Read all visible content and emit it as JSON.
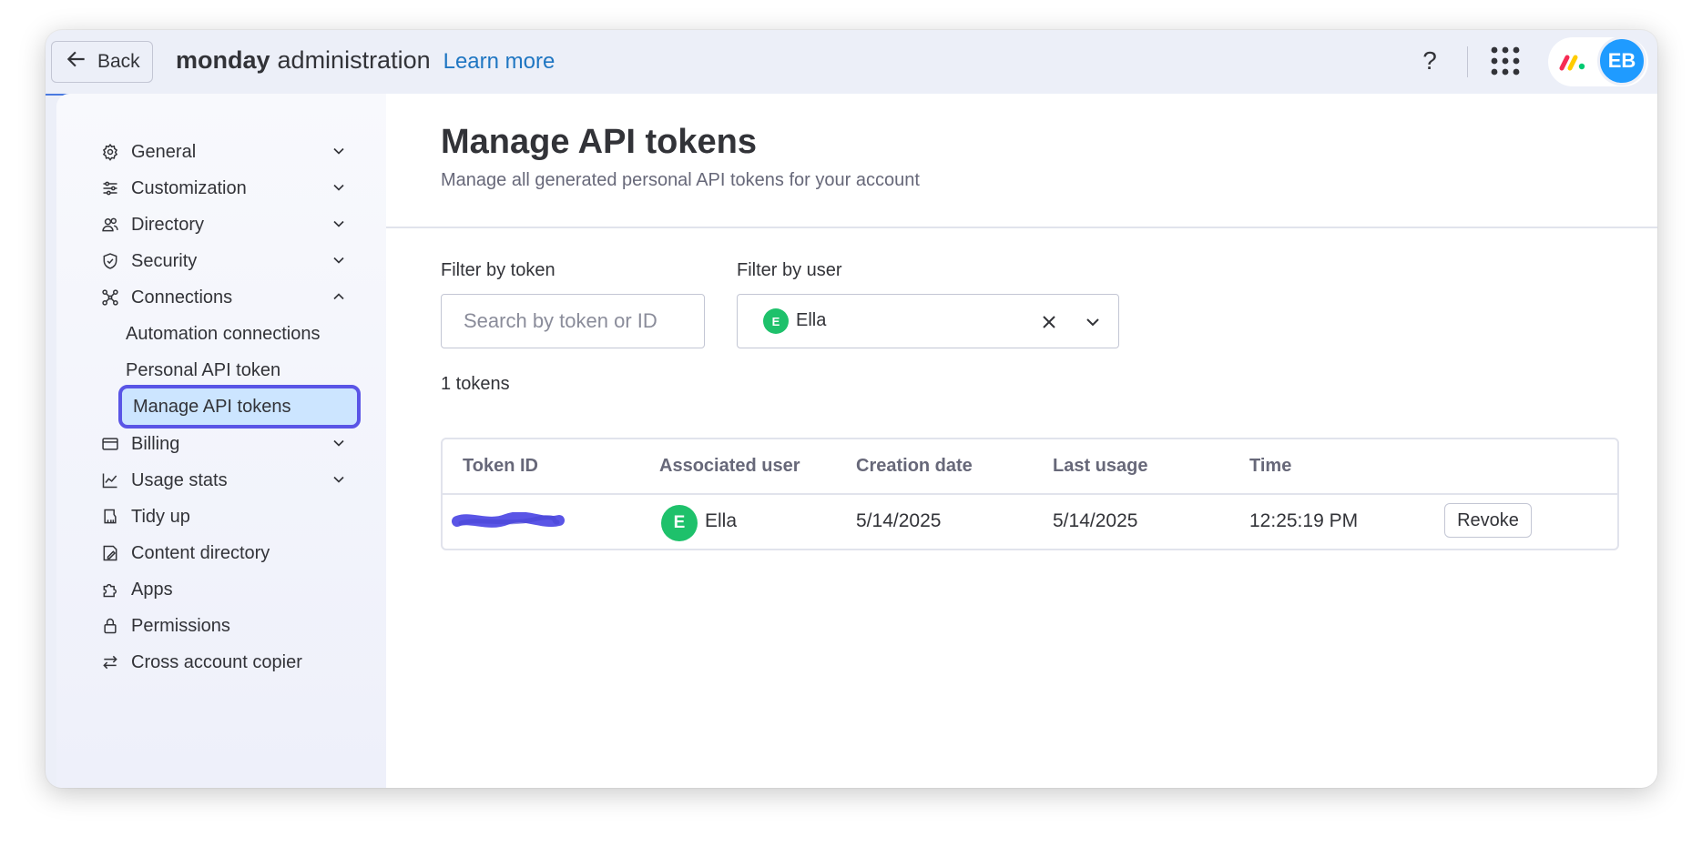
{
  "header": {
    "back_label": "Back",
    "brand_bold": "monday",
    "brand_rest": "administration",
    "learn_more": "Learn more",
    "help_label": "?",
    "avatar_initials": "EB"
  },
  "sidebar": {
    "items": [
      {
        "label": "General",
        "icon": "gear-icon",
        "expandable": true
      },
      {
        "label": "Customization",
        "icon": "sliders-icon",
        "expandable": true
      },
      {
        "label": "Directory",
        "icon": "people-icon",
        "expandable": true
      },
      {
        "label": "Security",
        "icon": "shield-icon",
        "expandable": true
      },
      {
        "label": "Connections",
        "icon": "connections-icon",
        "expandable": true,
        "expanded": true
      },
      {
        "label": "Automation connections",
        "sub": true
      },
      {
        "label": "Personal API token",
        "sub": true
      },
      {
        "label": "Manage API tokens",
        "sub": true,
        "active": true
      },
      {
        "label": "Billing",
        "icon": "card-icon",
        "expandable": true
      },
      {
        "label": "Usage stats",
        "icon": "chart-icon",
        "expandable": true
      },
      {
        "label": "Tidy up",
        "icon": "broom-icon"
      },
      {
        "label": "Content directory",
        "icon": "content-icon"
      },
      {
        "label": "Apps",
        "icon": "puzzle-icon"
      },
      {
        "label": "Permissions",
        "icon": "lock-icon"
      },
      {
        "label": "Cross account copier",
        "icon": "transfer-icon"
      }
    ]
  },
  "main": {
    "title": "Manage API tokens",
    "subtitle": "Manage all generated personal API tokens for your account",
    "filter_token_label": "Filter by token",
    "filter_token_placeholder": "Search by token or ID",
    "filter_user_label": "Filter by user",
    "filter_user_value": "Ella",
    "filter_user_initial": "E",
    "count_text": "1 tokens",
    "table": {
      "columns": [
        "Token ID",
        "Associated user",
        "Creation date",
        "Last usage",
        "Time"
      ],
      "rows": [
        {
          "token_id": "",
          "user_initial": "E",
          "user": "Ella",
          "creation_date": "5/14/2025",
          "last_usage": "5/14/2025",
          "time": "12:25:19 PM",
          "action": "Revoke"
        }
      ]
    }
  },
  "colors": {
    "accent_blue": "#1f76c2",
    "active_border": "#5a55e6",
    "active_bg": "#cce5ff",
    "avatar_green": "#1ec16b",
    "avatar_blue": "#1f9bff"
  }
}
